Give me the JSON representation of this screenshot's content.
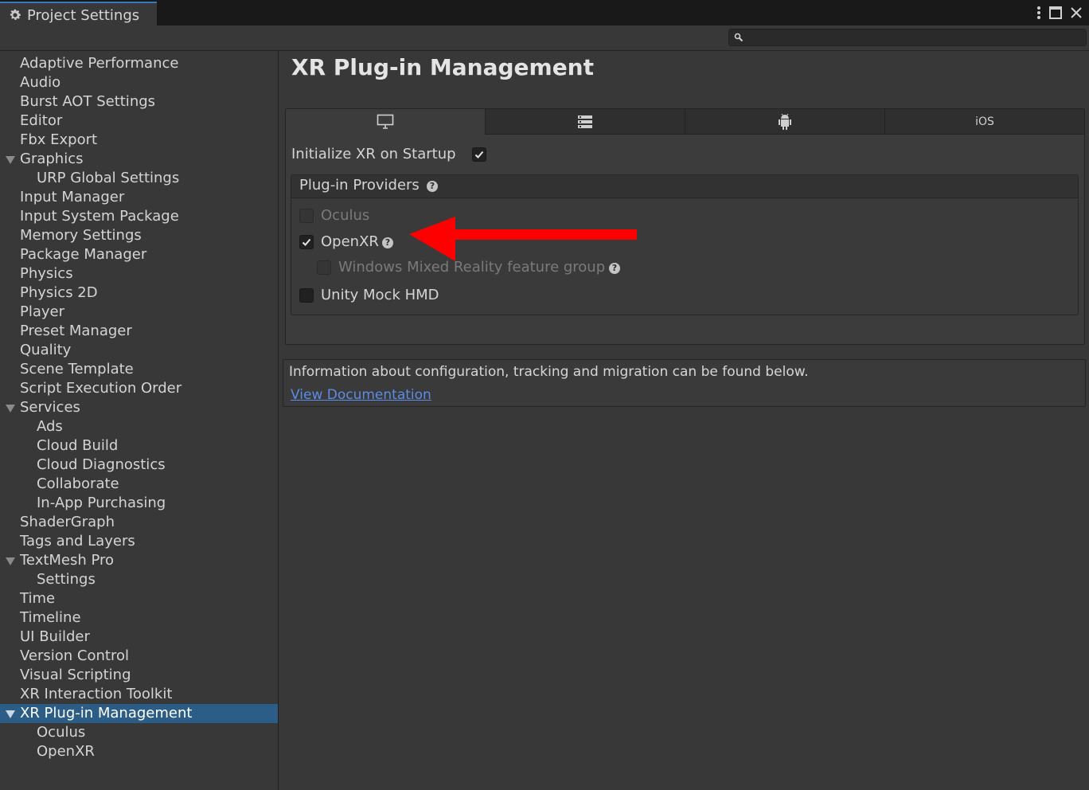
{
  "window": {
    "tab_title": "Project Settings",
    "search": {
      "placeholder": "",
      "value": ""
    }
  },
  "sidebar": {
    "items": [
      {
        "label": "Adaptive Performance"
      },
      {
        "label": "Audio"
      },
      {
        "label": "Burst AOT Settings"
      },
      {
        "label": "Editor"
      },
      {
        "label": "Fbx Export"
      },
      {
        "label": "Graphics",
        "expanded": true
      },
      {
        "label": "URP Global Settings",
        "child": true
      },
      {
        "label": "Input Manager"
      },
      {
        "label": "Input System Package"
      },
      {
        "label": "Memory Settings"
      },
      {
        "label": "Package Manager"
      },
      {
        "label": "Physics"
      },
      {
        "label": "Physics 2D"
      },
      {
        "label": "Player"
      },
      {
        "label": "Preset Manager"
      },
      {
        "label": "Quality"
      },
      {
        "label": "Scene Template"
      },
      {
        "label": "Script Execution Order"
      },
      {
        "label": "Services",
        "expanded": true
      },
      {
        "label": "Ads",
        "child": true
      },
      {
        "label": "Cloud Build",
        "child": true
      },
      {
        "label": "Cloud Diagnostics",
        "child": true
      },
      {
        "label": "Collaborate",
        "child": true
      },
      {
        "label": "In-App Purchasing",
        "child": true
      },
      {
        "label": "ShaderGraph"
      },
      {
        "label": "Tags and Layers"
      },
      {
        "label": "TextMesh Pro",
        "expanded": true
      },
      {
        "label": "Settings",
        "child": true
      },
      {
        "label": "Time"
      },
      {
        "label": "Timeline"
      },
      {
        "label": "UI Builder"
      },
      {
        "label": "Version Control"
      },
      {
        "label": "Visual Scripting"
      },
      {
        "label": "XR Interaction Toolkit"
      },
      {
        "label": "XR Plug-in Management",
        "expanded": true,
        "selected": true
      },
      {
        "label": "Oculus",
        "child": true
      },
      {
        "label": "OpenXR",
        "child": true
      }
    ]
  },
  "main": {
    "title": "XR Plug-in Management",
    "platform_tabs": [
      {
        "icon": "desktop-icon",
        "label": "",
        "active": true
      },
      {
        "icon": "server-icon",
        "label": ""
      },
      {
        "icon": "android-icon",
        "label": ""
      },
      {
        "icon": "",
        "label": "iOS"
      }
    ],
    "init_label": "Initialize XR on Startup",
    "init_checked": true,
    "providers_header": "Plug-in Providers",
    "providers": {
      "oculus": {
        "label": "Oculus",
        "checked": false,
        "disabled": true
      },
      "openxr": {
        "label": "OpenXR",
        "checked": true
      },
      "wmr": {
        "label": "Windows Mixed Reality feature group",
        "checked": false,
        "disabled": true
      },
      "mock": {
        "label": "Unity Mock HMD",
        "checked": false
      }
    },
    "info_text": "Information about configuration, tracking and migration can be found below.",
    "doc_link": "View Documentation"
  },
  "colors": {
    "selection": "#2c5d87",
    "link": "#5b8ce8",
    "annotation_arrow": "#ff0000"
  }
}
